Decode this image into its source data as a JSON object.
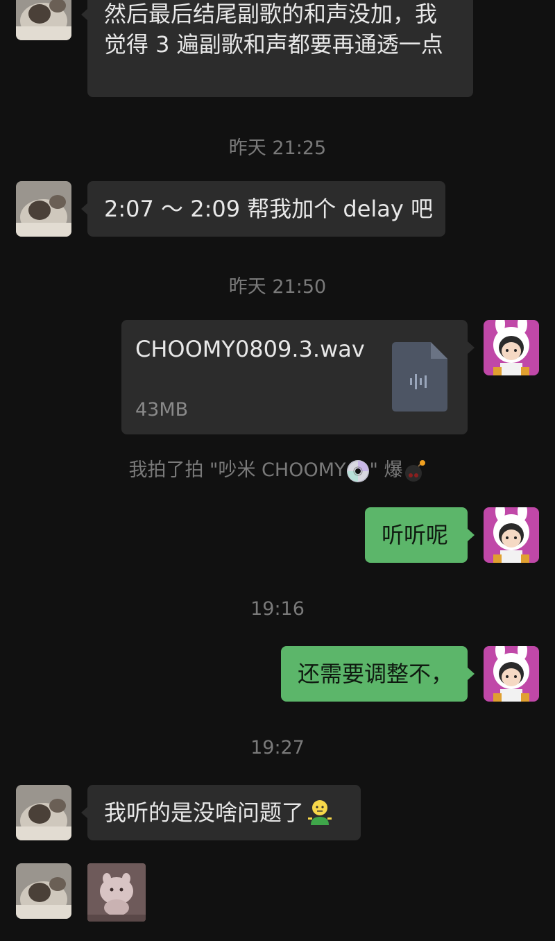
{
  "messages": {
    "m1": {
      "text": "然后最后结尾副歌的和声没加，我觉得 3 遍副歌和声都要再通透一点"
    },
    "m2": {
      "text": "2:07 ～ 2:09 帮我加个 delay 吧"
    },
    "file": {
      "name": "CHOOMY0809.3.wav",
      "size": "43MB",
      "icon": "audio-file-icon"
    },
    "m3": {
      "text": "听听呢"
    },
    "m4": {
      "text": "还需要调整不，"
    },
    "m5": {
      "text": "我听的是没啥问题了"
    }
  },
  "timestamps": {
    "t1": "昨天 21:25",
    "t2": "昨天 21:50",
    "t3": "19:16",
    "t4": "19:27"
  },
  "pat": {
    "prefix": "我拍了拍 \"吵米 CHOOMY",
    "suffix": "\" 爆",
    "icons": [
      "cd-icon",
      "bomb-icon"
    ]
  },
  "avatars": {
    "contact": "cat-avatar",
    "me": "bunny-hood-girl-avatar"
  },
  "colors": {
    "background": "#111111",
    "incoming_bubble": "#2c2c2c",
    "outgoing_bubble": "#5cb66a",
    "timestamp": "#7a7a7a"
  }
}
